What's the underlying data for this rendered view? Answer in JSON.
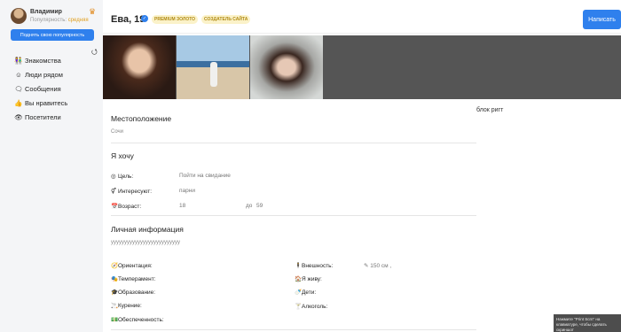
{
  "sidebar": {
    "user_name": "Владимир",
    "popularity_label": "Популярность:",
    "popularity_level": "средняя",
    "raise_button": "Поднять свою популярность",
    "refresh_icon": "⭯",
    "nav_items": [
      {
        "label": "Знакомства",
        "icon": "people-icon",
        "glyph": "👫"
      },
      {
        "label": "Люди рядом",
        "icon": "smile-icon",
        "glyph": "☺"
      },
      {
        "label": "Сообщения",
        "icon": "chat-icon",
        "glyph": "🗨"
      },
      {
        "label": "Вы нравитесь",
        "icon": "thumbs-up-icon",
        "glyph": "👍"
      },
      {
        "label": "Посетители",
        "icon": "eye-icon",
        "glyph": "👁"
      }
    ]
  },
  "header": {
    "title": "Ева, 19",
    "badge_premium": "PREMIUM ЗОЛОТО",
    "badge_creator": "СОЗДАТЕЛЬ САЙТА",
    "write_button": "Написать"
  },
  "location": {
    "title": "Местоположение",
    "city": "Сочи"
  },
  "wants": {
    "title": "Я хочу",
    "goal_label": "Цель:",
    "goal_value": "Пойти на свидание",
    "interested_label": "Интересуют:",
    "interested_value": "парни",
    "age_label": "Возраст:",
    "age_from": "18",
    "age_to_label": "до",
    "age_to": "59"
  },
  "personal": {
    "title": "Личная информация",
    "about": "уууууууууууууууууууууууууу",
    "left": [
      {
        "label": "Ориентация:",
        "icon": "compass-icon",
        "glyph": "🧭"
      },
      {
        "label": "Темперамент:",
        "icon": "mask-icon",
        "glyph": "🎭"
      },
      {
        "label": "Образование:",
        "icon": "graduation-icon",
        "glyph": "🎓"
      },
      {
        "label": "Курение:",
        "icon": "cigarette-icon",
        "glyph": "🚬"
      },
      {
        "label": "Обеспеченность:",
        "icon": "money-icon",
        "glyph": "💵"
      }
    ],
    "right": [
      {
        "label": "Внешность:",
        "icon": "figure-icon",
        "glyph": "🕴",
        "value": "150 см ,"
      },
      {
        "label": "Я живу:",
        "icon": "house-icon",
        "glyph": "🏠",
        "value": ""
      },
      {
        "label": "Дети:",
        "icon": "baby-bottle-icon",
        "glyph": "🍼",
        "value": ""
      },
      {
        "label": "Алкоголь:",
        "icon": "glass-icon",
        "glyph": "🍸",
        "value": ""
      }
    ]
  },
  "right_block": "блок ригт",
  "toast": "Нажмите \"Print Scrn\" на клавиатуре, чтобы сделать скриншот"
}
